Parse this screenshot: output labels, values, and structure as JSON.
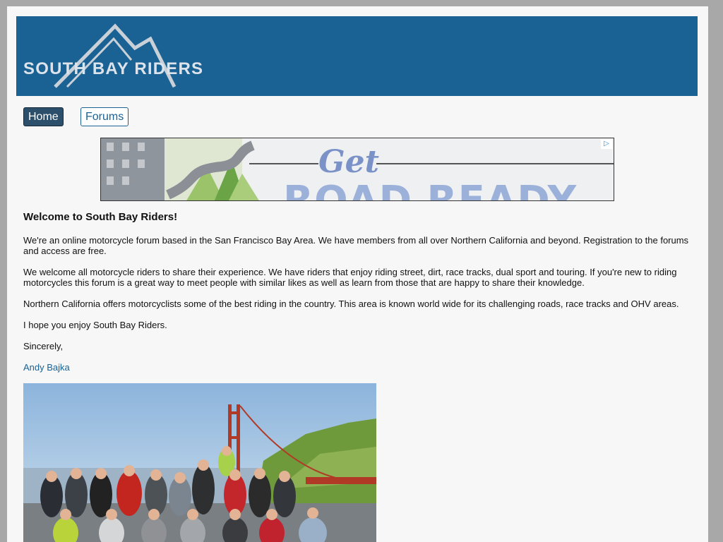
{
  "header": {
    "logo_text": "SOUTH BAY RIDERS",
    "colors": {
      "banner": "#1a6294",
      "logo_text": "#dde3ea"
    }
  },
  "nav": {
    "items": [
      {
        "label": "Home",
        "active": true
      },
      {
        "label": "Forums",
        "active": false
      }
    ]
  },
  "ad": {
    "headline_top": "Get",
    "headline_bottom": "ROAD READY",
    "choices_icon": "ad-choices-icon"
  },
  "main": {
    "title": "Welcome to South Bay Riders!",
    "paragraphs": [
      "We're an online motorcycle forum based in the San Francisco Bay Area. We have members from all over Northern California and beyond. Registration to the forums and access are free.",
      "We welcome all motorcycle riders to share their experience. We have riders that enjoy riding street, dirt, race tracks, dual sport and touring. If you're new to riding motorcycles this forum is a great way to meet people with similar likes as well as learn from those that are happy to share their knowledge.",
      "Northern California offers motorcyclists some of the best riding in the country. This area is known world wide for its challenging roads, race tracks and OHV areas.",
      "I hope you enjoy South Bay Riders.",
      "Sincerely,"
    ],
    "author": "Andy Bajka",
    "photo": "group-photo"
  }
}
